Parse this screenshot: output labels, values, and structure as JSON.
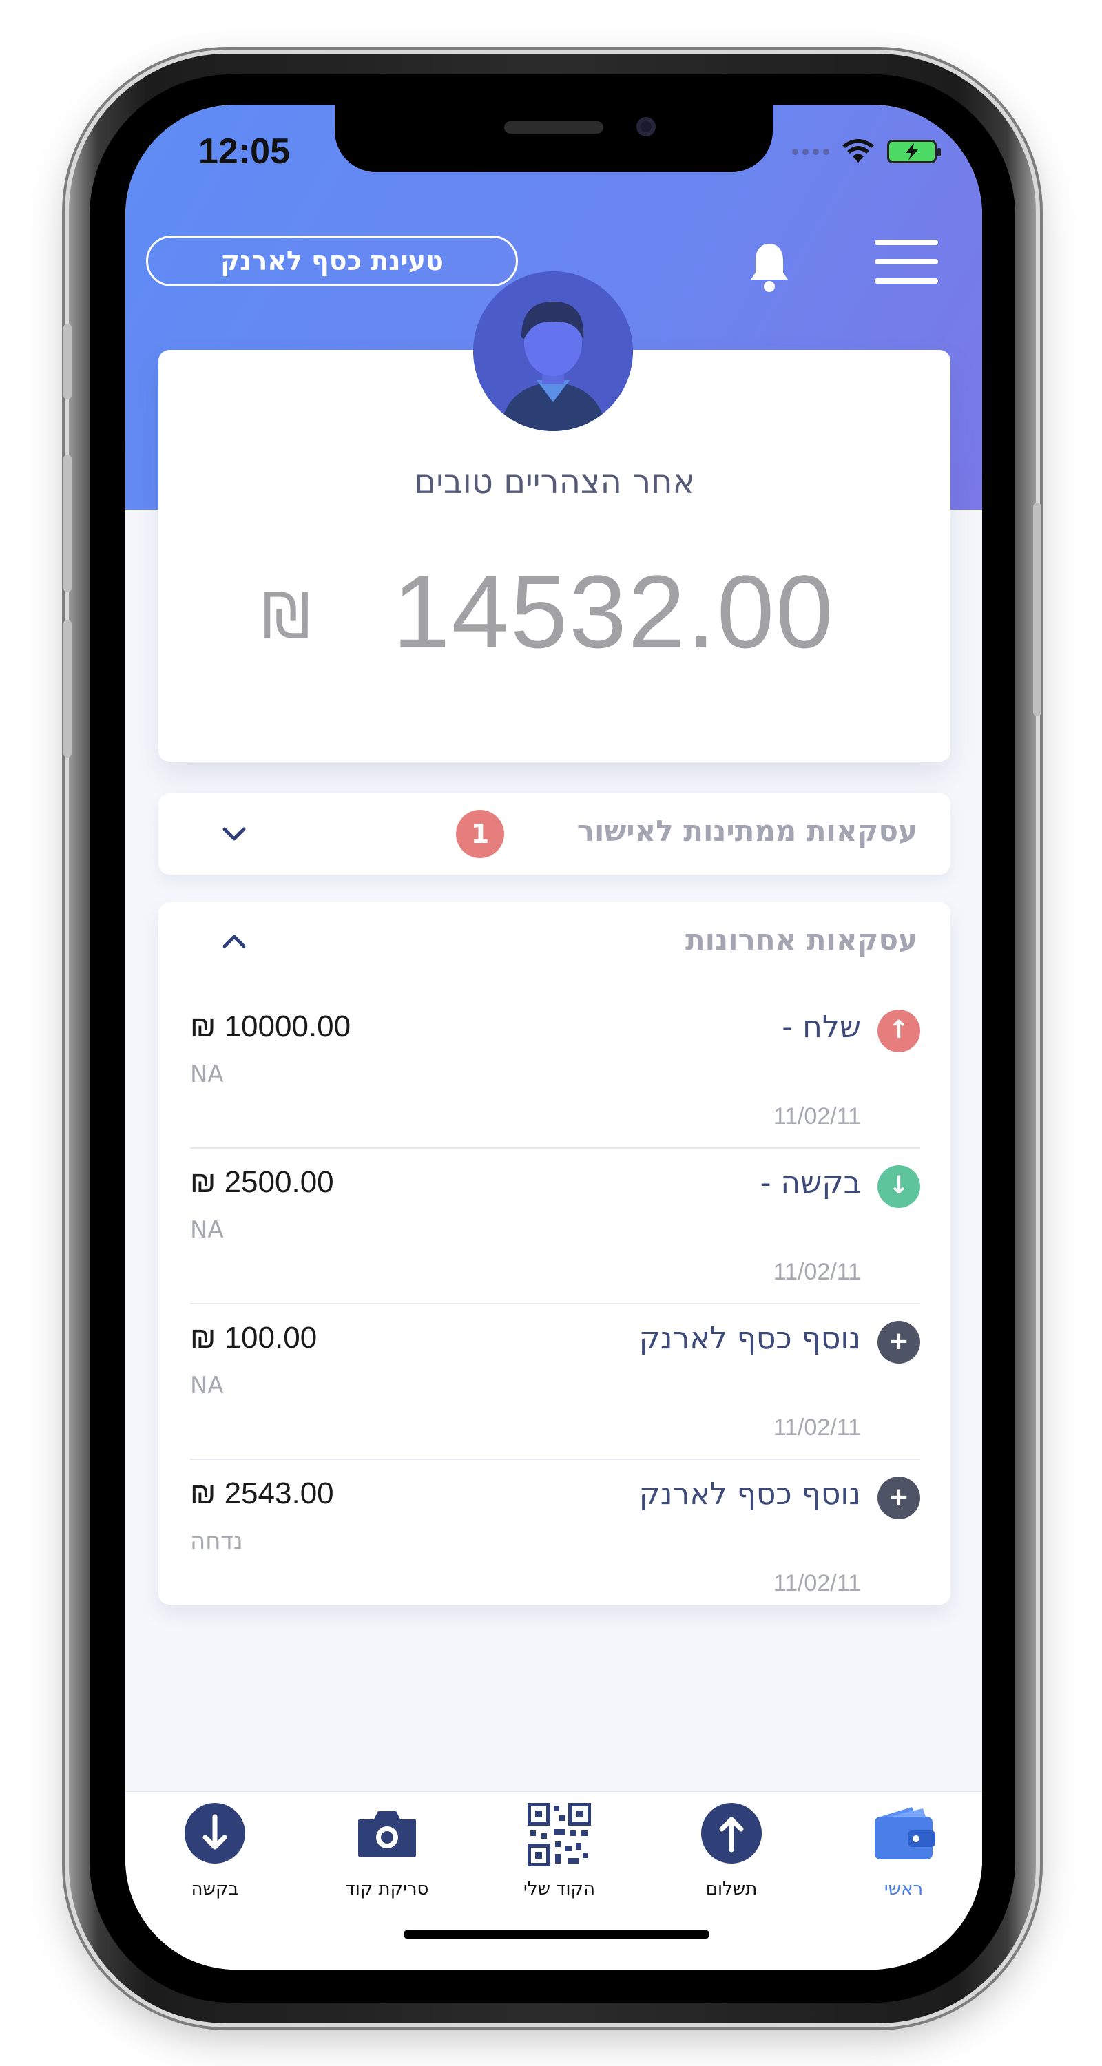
{
  "status_bar": {
    "time": "12:05"
  },
  "header": {
    "load_wallet_label": "טעינת כסף לארנק",
    "bell_icon": "bell-icon",
    "menu_icon": "menu-icon"
  },
  "balance": {
    "greeting": "אחר הצהריים טובים",
    "amount": "14532.00",
    "currency": "₪"
  },
  "pending": {
    "title": "עסקאות ממתינות לאישור",
    "count": "1"
  },
  "recent": {
    "title": "עסקאות אחרונות",
    "transactions": [
      {
        "label": "שלח -",
        "amount": "₪ 10000.00",
        "note": "NA",
        "date": "11/02/11",
        "icon": "arrow-up-icon",
        "color": "#e57e7d",
        "glyph": "↑"
      },
      {
        "label": "בקשה -",
        "amount": "₪ 2500.00",
        "note": "NA",
        "date": "11/02/11",
        "icon": "arrow-down-icon",
        "color": "#5ec49c",
        "glyph": "↓"
      },
      {
        "label": "נוסף כסף לארנק",
        "amount": "₪ 100.00",
        "note": "NA",
        "date": "11/02/11",
        "icon": "plus-icon",
        "color": "#4f5366",
        "glyph": "+"
      },
      {
        "label": "נוסף כסף לארנק",
        "amount": "₪ 2543.00",
        "note": "נדחה",
        "date": "11/02/11",
        "icon": "plus-icon",
        "color": "#4f5366",
        "glyph": "+"
      }
    ]
  },
  "tabbar": {
    "tabs": [
      {
        "label": "בקשה",
        "icon": "arrow-down-circle-icon"
      },
      {
        "label": "סריקת קוד",
        "icon": "camera-icon"
      },
      {
        "label": "הקוד שלי",
        "icon": "qr-code-icon"
      },
      {
        "label": "תשלום",
        "icon": "arrow-up-circle-icon"
      },
      {
        "label": "ראשי",
        "icon": "wallet-icon",
        "active": true
      }
    ]
  },
  "colors": {
    "header_gradient_start": "#5f8cf5",
    "header_gradient_end": "#7a78e6",
    "accent": "#4a7fe8",
    "navy": "#2f3f78",
    "send": "#e57e7d",
    "request": "#5ec49c"
  }
}
